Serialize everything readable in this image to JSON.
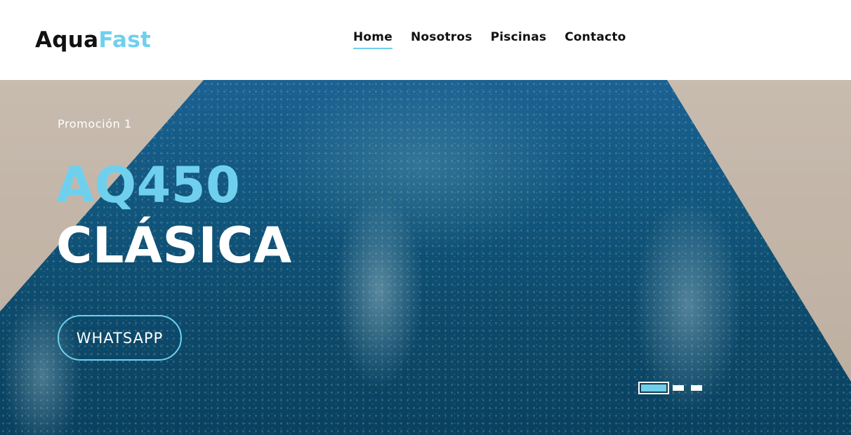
{
  "header": {
    "logo_part1": "Aqua",
    "logo_part2": "Fast",
    "nav": [
      {
        "label": "Home",
        "active": true
      },
      {
        "label": "Nosotros",
        "active": false
      },
      {
        "label": "Piscinas",
        "active": false
      },
      {
        "label": "Contacto",
        "active": false
      }
    ]
  },
  "hero": {
    "promo_label": "Promoción 1",
    "title_line1": "AQ450",
    "title_line2": "CLÁSICA",
    "cta_label": "WHATSAPP",
    "slides_count": 3,
    "active_slide": 1
  },
  "colors": {
    "accent": "#6fd0ee",
    "text_dark": "#111111",
    "text_light": "#ffffff"
  }
}
